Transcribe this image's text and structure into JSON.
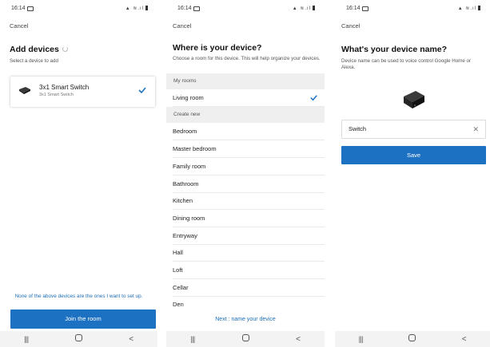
{
  "status_bar": {
    "time": "16:14"
  },
  "common": {
    "cancel_label": "Cancel"
  },
  "screen1": {
    "title": "Add devices",
    "subtitle": "Select a device to add",
    "device": {
      "name": "3x1 Smart Switch",
      "sub": "3x1 Smart Switch",
      "selected": true
    },
    "none_text": "None of the above devices are the ones I want to set up.",
    "join_label": "Join the room"
  },
  "screen2": {
    "title": "Where is your device?",
    "subtitle": "Choose a room for this device. This will help organize your devices.",
    "my_rooms_header": "My rooms",
    "my_rooms": [
      {
        "label": "Living room",
        "selected": true
      }
    ],
    "create_new_header": "Create new",
    "new_rooms": [
      "Bedroom",
      "Master bedroom",
      "Family room",
      "Bathroom",
      "Kitchen",
      "Dining room",
      "Entryway",
      "Hall",
      "Loft",
      "Cellar",
      "Den"
    ],
    "next_label": "Next : name your device"
  },
  "screen3": {
    "title": "What's your device name?",
    "subtitle": "Device name can be used to voice control Google Home or Alexa.",
    "name_value": "Switch",
    "save_label": "Save"
  },
  "navbar": {
    "recent_glyph": "|||",
    "back_glyph": "<"
  },
  "colors": {
    "accent": "#1c71c3",
    "link": "#1e6fb8",
    "check": "#1c71c3",
    "section_bg": "#efefef"
  },
  "icons": [
    "image-icon",
    "status-icons",
    "spinner-icon",
    "device-icon",
    "check-icon",
    "clear-icon",
    "recent-apps-icon",
    "home-icon",
    "back-icon"
  ]
}
